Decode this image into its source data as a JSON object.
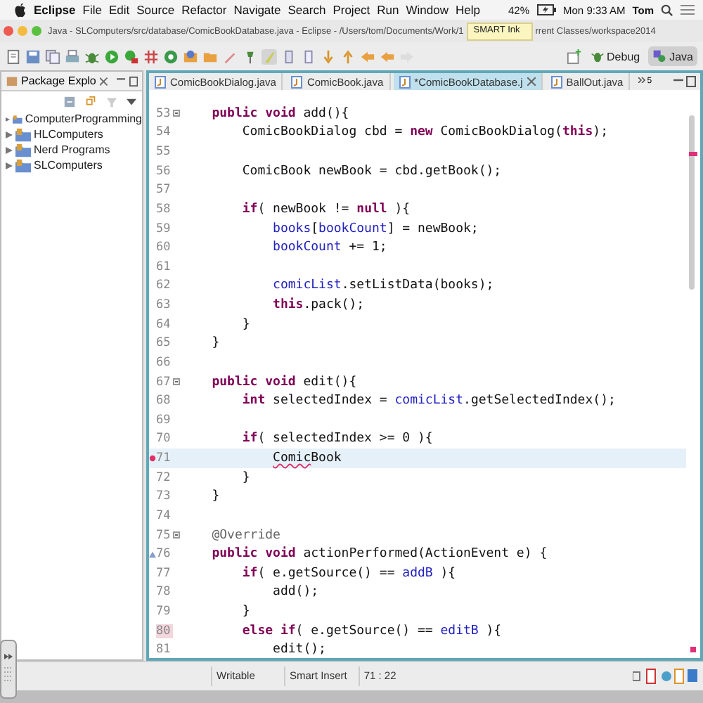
{
  "menu_bar": {
    "app": "Eclipse",
    "items": [
      "File",
      "Edit",
      "Source",
      "Refactor",
      "Navigate",
      "Search",
      "Project",
      "Run",
      "Window",
      "Help"
    ],
    "battery": "42%",
    "clock": "Mon 9:33 AM",
    "user": "Tom"
  },
  "window": {
    "title": "Java - SLComputers/src/database/ComicBookDatabase.java - Eclipse - /Users/tom/Documents/Work/1",
    "title_rest": "rrent Classes/workspace2014",
    "tooltip": "SMART Ink"
  },
  "perspectives": [
    {
      "label": "Debug",
      "selected": false
    },
    {
      "label": "Java",
      "selected": true
    }
  ],
  "package_explorer": {
    "title": "Package Explo",
    "items": [
      {
        "label": "ComputerProgramming",
        "expanded": false
      },
      {
        "label": "HLComputers",
        "expanded": false
      },
      {
        "label": "Nerd Programs",
        "expanded": false
      },
      {
        "label": "SLComputers",
        "expanded": false
      }
    ]
  },
  "editor_tabs": [
    {
      "label": "ComicBookDialog.java",
      "selected": false
    },
    {
      "label": "ComicBook.java",
      "selected": false
    },
    {
      "label": "*ComicBookDatabase.j",
      "selected": true
    },
    {
      "label": "BallOut.java",
      "selected": false
    }
  ],
  "hidden_tabs": "5",
  "code": [
    {
      "n": "53",
      "fold": true,
      "segs": [
        {
          "kind": "keyword",
          "t": "    public void"
        },
        {
          "kind": "plain",
          "t": " add(){"
        }
      ]
    },
    {
      "n": "54",
      "segs": [
        {
          "kind": "plain",
          "t": "        ComicBookDialog cbd = "
        },
        {
          "kind": "keyword",
          "t": "new"
        },
        {
          "kind": "plain",
          "t": " ComicBookDialog("
        },
        {
          "kind": "keyword",
          "t": "this"
        },
        {
          "kind": "plain",
          "t": ");"
        }
      ]
    },
    {
      "n": "55"
    },
    {
      "n": "56",
      "segs": [
        {
          "kind": "plain",
          "t": "        ComicBook newBook = cbd.getBook();"
        }
      ]
    },
    {
      "n": "57"
    },
    {
      "n": "58",
      "segs": [
        {
          "kind": "keyword",
          "t": "        if"
        },
        {
          "kind": "plain",
          "t": "( newBook != "
        },
        {
          "kind": "keyword",
          "t": "null"
        },
        {
          "kind": "plain",
          "t": " ){"
        }
      ]
    },
    {
      "n": "59",
      "segs": [
        {
          "kind": "field",
          "t": "            books"
        },
        {
          "kind": "plain",
          "t": "["
        },
        {
          "kind": "field",
          "t": "bookCount"
        },
        {
          "kind": "plain",
          "t": "] = newBook;"
        }
      ]
    },
    {
      "n": "60",
      "segs": [
        {
          "kind": "field",
          "t": "            bookCount"
        },
        {
          "kind": "plain",
          "t": " += 1;"
        }
      ]
    },
    {
      "n": "61"
    },
    {
      "n": "62",
      "segs": [
        {
          "kind": "field",
          "t": "            comicList"
        },
        {
          "kind": "plain",
          "t": ".setListData(books);"
        }
      ]
    },
    {
      "n": "63",
      "segs": [
        {
          "kind": "keyword",
          "t": "            this"
        },
        {
          "kind": "plain",
          "t": ".pack();"
        }
      ]
    },
    {
      "n": "64",
      "segs": [
        {
          "kind": "plain",
          "t": "        }"
        }
      ]
    },
    {
      "n": "65",
      "segs": [
        {
          "kind": "plain",
          "t": "    }"
        }
      ]
    },
    {
      "n": "66"
    },
    {
      "n": "67",
      "fold": true,
      "segs": [
        {
          "kind": "keyword",
          "t": "    public void"
        },
        {
          "kind": "plain",
          "t": " edit(){"
        }
      ]
    },
    {
      "n": "68",
      "segs": [
        {
          "kind": "keyword",
          "t": "        int"
        },
        {
          "kind": "plain",
          "t": " selectedIndex = "
        },
        {
          "kind": "field",
          "t": "comicList"
        },
        {
          "kind": "plain",
          "t": ".getSelectedIndex();"
        }
      ]
    },
    {
      "n": "69"
    },
    {
      "n": "70",
      "segs": [
        {
          "kind": "keyword",
          "t": "        if"
        },
        {
          "kind": "plain",
          "t": "( selectedIndex >= 0 ){"
        }
      ]
    },
    {
      "n": "71",
      "current": true,
      "error": true,
      "segs": [
        {
          "kind": "error",
          "t": "            Comic"
        },
        {
          "kind": "plain",
          "t": "Book"
        }
      ]
    },
    {
      "n": "72",
      "segs": [
        {
          "kind": "plain",
          "t": "        }"
        }
      ]
    },
    {
      "n": "73",
      "segs": [
        {
          "kind": "plain",
          "t": "    }"
        }
      ]
    },
    {
      "n": "74"
    },
    {
      "n": "75",
      "fold": true,
      "segs": [
        {
          "kind": "annotation",
          "t": "    @Override"
        }
      ]
    },
    {
      "n": "76",
      "override": true,
      "segs": [
        {
          "kind": "keyword",
          "t": "    public void"
        },
        {
          "kind": "plain",
          "t": " actionPerformed(ActionEvent e) {"
        }
      ]
    },
    {
      "n": "77",
      "segs": [
        {
          "kind": "keyword",
          "t": "        if"
        },
        {
          "kind": "plain",
          "t": "( e.getSource() == "
        },
        {
          "kind": "field",
          "t": "addB"
        },
        {
          "kind": "plain",
          "t": " ){"
        }
      ]
    },
    {
      "n": "78",
      "segs": [
        {
          "kind": "plain",
          "t": "            add();"
        }
      ]
    },
    {
      "n": "79",
      "segs": [
        {
          "kind": "plain",
          "t": "        }"
        }
      ]
    },
    {
      "n": "80",
      "flagged": true,
      "segs": [
        {
          "kind": "keyword",
          "t": "        else if"
        },
        {
          "kind": "plain",
          "t": "( e.getSource() == "
        },
        {
          "kind": "field",
          "t": "editB"
        },
        {
          "kind": "plain",
          "t": " ){"
        }
      ]
    },
    {
      "n": "81",
      "segs": [
        {
          "kind": "plain",
          "t": "            edit();"
        }
      ]
    }
  ],
  "status_bar": [
    "Writable",
    "Smart Insert",
    "71 : 22"
  ]
}
